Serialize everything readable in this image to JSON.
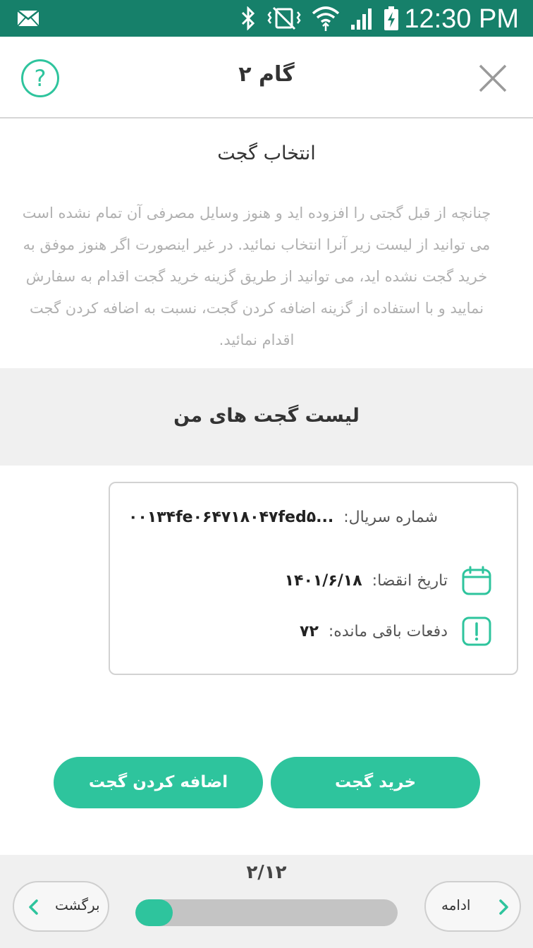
{
  "status_bar": {
    "time": "12:30 PM",
    "icons": [
      "mail-icon",
      "bluetooth-icon",
      "vibrate-icon",
      "wifi-icon",
      "signal-icon",
      "battery-charging-icon"
    ]
  },
  "header": {
    "title": "گام ۲",
    "help_icon": "?"
  },
  "intro": {
    "title": "انتخاب گجت",
    "text": "چنانچه از قبل گجتی را افزوده اید و هنوز وسایل مصرفی آن تمام نشده است می توانید از لیست زیر آنرا انتخاب نمائید. در غیر اینصورت اگر هنوز موفق به خرید  گجت نشده اید، می توانید از طریق گزینه خرید گجت اقدام به سفارش نمایید و با استفاده از گزینه اضافه کردن گجت، نسبت به اضافه کردن گجت اقدام نمائید."
  },
  "list": {
    "title": "لیست گجت های من",
    "card": {
      "serial_label": "شماره سریال:",
      "serial_value": "۰۰۱۳۴fe۰۶۴۷۱۸۰۴۷fed۵...",
      "expiry_label": "تاریخ انقضا:",
      "expiry_value": "۱۴۰۱/۶/۱۸",
      "remaining_label": "دفعات باقی مانده:",
      "remaining_value": "۷۲"
    }
  },
  "buttons": {
    "add_gadget": "اضافه کردن گجت",
    "buy_gadget": "خرید گجت"
  },
  "footer": {
    "page_indicator": "۲/۱۲",
    "progress_fraction": 0.1429,
    "back_label": "برگشت",
    "next_label": "ادامه"
  },
  "colors": {
    "accent": "#2ec49d",
    "status_bar": "#16806a",
    "band": "#f0f0f0"
  }
}
